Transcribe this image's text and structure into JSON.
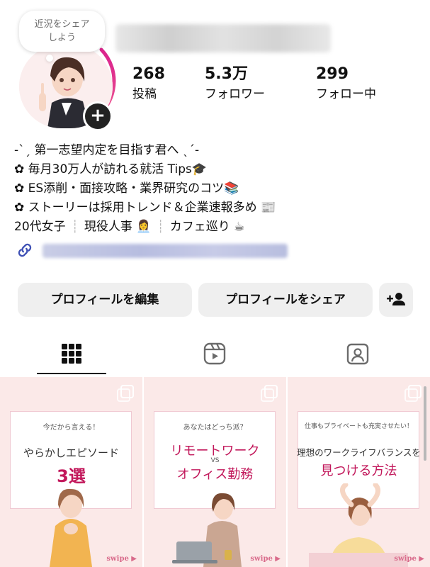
{
  "profile": {
    "note": "近況をシェア\nしよう",
    "note_line1": "近況をシェア",
    "note_line2": "しよう",
    "add_story_glyph": "+"
  },
  "stats": [
    {
      "value": "268",
      "label": "投稿"
    },
    {
      "value": "5.3万",
      "label": "フォロワー"
    },
    {
      "value": "299",
      "label": "フォロー中"
    }
  ],
  "bio": {
    "line1": "-ˋˏ 第一志望内定を目指す君へ ˎˊ-",
    "line2": "✿ 毎月30万人が訪れる就活 Tips🎓",
    "line3": "✿ ES添削・面接攻略・業界研究のコツ📚",
    "line4": "✿ ストーリーは採用トレンド＆企業速報多め 📰",
    "tags": [
      "20代女子",
      "現役人事 👩‍💼",
      "カフェ巡り ☕"
    ],
    "tag_separator": "┊"
  },
  "buttons": {
    "edit_profile": "プロフィールを編集",
    "share_profile": "プロフィールをシェア"
  },
  "icons": {
    "grid": "grid-icon",
    "reels": "reels-icon",
    "tagged": "tagged-person-icon",
    "add_person": "add-person-icon",
    "link": "link-icon"
  },
  "colors": {
    "story_ring_start": "#f9a825",
    "story_ring_end": "#d81b8c",
    "button_bg": "#efefef",
    "tile_bg": "#fbe9e8",
    "accent_pink": "#c2185b",
    "link_blue": "#3f51b5"
  },
  "posts": [
    {
      "small": "今だから言える！",
      "title": "やらかしエピソード",
      "emphasis": "3選",
      "swipe": "swipe ▶"
    },
    {
      "small": "あなたはどっち派？",
      "title_top": "リモートワーク",
      "vs": "VS",
      "title_bottom": "オフィス勤務",
      "swipe": "swipe ▶"
    },
    {
      "small": "仕事もプライベートも充実させたい！",
      "title": "理想のワークライフバランスを",
      "emphasis": "見つける方法",
      "swipe": "swipe ▶"
    }
  ]
}
